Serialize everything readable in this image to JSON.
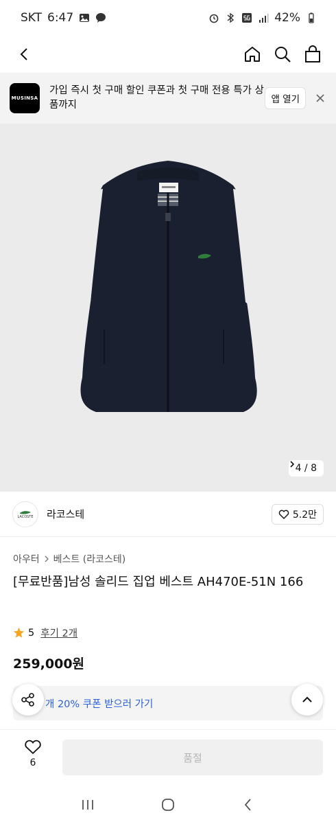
{
  "status_bar": {
    "carrier": "SKT",
    "time": "6:47",
    "battery": "42%"
  },
  "banner": {
    "logo_text": "MUSINSA",
    "message": "가입 즉시 첫 구매 할인 쿠폰과 첫 구매 전용 특가 상품까지",
    "open_app": "앱 열기"
  },
  "gallery": {
    "pager": "4 / 8"
  },
  "brand": {
    "name": "라코스테",
    "logo_text": "LACOSTE",
    "likes": "5.2만"
  },
  "breadcrumb": {
    "level1": "아우터",
    "level2": "베스트 (라코스테)"
  },
  "product": {
    "title": "[무료반품]남성 솔리드 집업 베스트 AH470E-51N 166",
    "rating": "5",
    "reviews": "후기 2개",
    "price": "259,000원"
  },
  "coupon": {
    "text": "개 20% 쿠폰 받으러 가기"
  },
  "bottom": {
    "wish_count": "6",
    "buy_label": "품절"
  },
  "colors": {
    "accent_blue": "#2a5fe0",
    "star": "#f5a623",
    "vest": "#1b2030",
    "hero_bg": "#ebebeb"
  },
  "icons": [
    "back-icon",
    "home-icon",
    "search-icon",
    "bag-icon",
    "close-icon",
    "heart-icon",
    "star-icon",
    "share-icon",
    "chevron-up-icon",
    "chevron-right-icon"
  ]
}
